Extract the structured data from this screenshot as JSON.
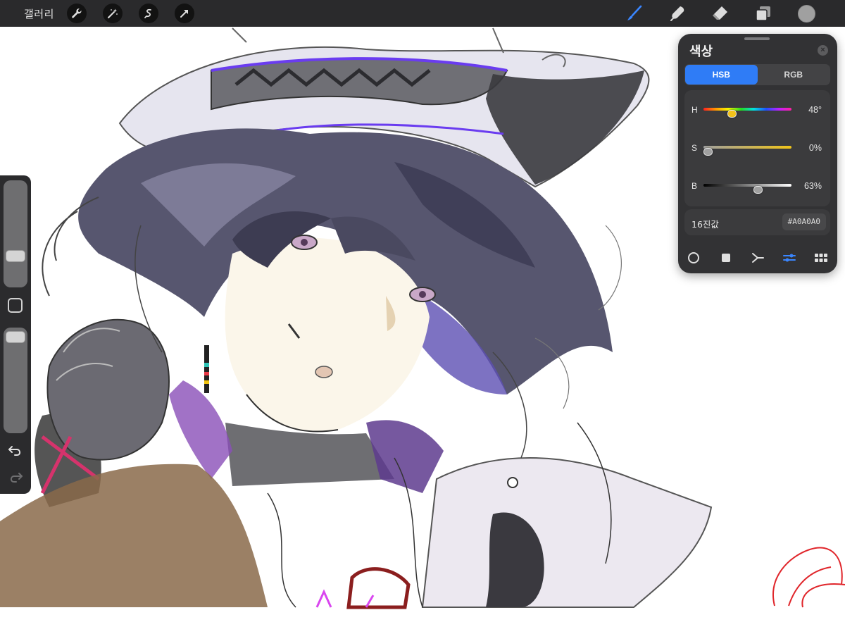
{
  "topbar": {
    "gallery_label": "갤러리",
    "left_tools": [
      "wrench-icon",
      "magic-wand-icon",
      "selection-icon",
      "transform-arrow-icon"
    ],
    "right_tools": [
      "brush-icon",
      "smudge-icon",
      "eraser-icon",
      "layers-icon",
      "color-icon"
    ],
    "active_tool": "brush-icon",
    "current_color": "#A0A0A0",
    "accent_color": "#2F7CF6"
  },
  "sidebar": {
    "brush_size": 0.26,
    "opacity": 0.98,
    "icons": [
      "modify-square-icon",
      "undo-icon",
      "redo-icon"
    ]
  },
  "color_panel": {
    "title": "색상",
    "tabs": [
      {
        "label": "HSB",
        "active": true
      },
      {
        "label": "RGB",
        "active": false
      }
    ],
    "sliders": [
      {
        "letter": "H",
        "value": "48°",
        "fraction": 0.3
      },
      {
        "letter": "S",
        "value": "0%",
        "fraction": 0.0
      },
      {
        "letter": "B",
        "value": "63%",
        "fraction": 0.63
      }
    ],
    "hex_label": "16진값",
    "hex_value": "#A0A0A0",
    "modes": [
      "disc-mode-icon",
      "classic-mode-icon",
      "harmony-mode-icon",
      "value-mode-icon",
      "palette-mode-icon"
    ],
    "active_mode": "value-mode-icon"
  },
  "canvas": {
    "content": "digital-sketch-illustration"
  }
}
